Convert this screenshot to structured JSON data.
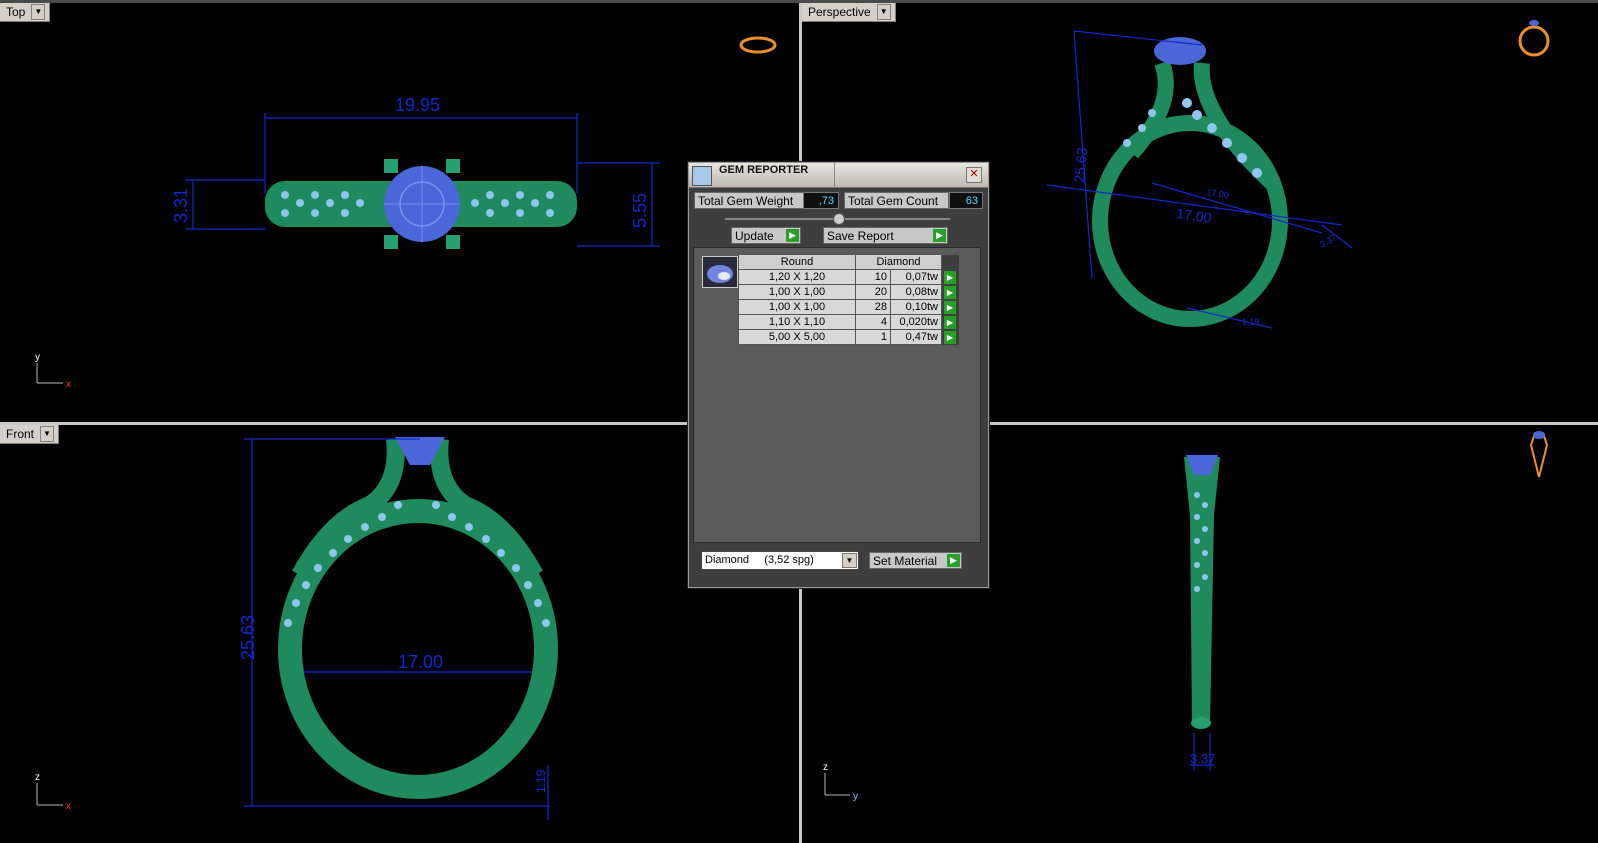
{
  "viewports": {
    "top": {
      "label": "Top",
      "dims": [
        "19.95",
        "3.31",
        "5.55"
      ],
      "axes": [
        "y",
        "x"
      ]
    },
    "perspective": {
      "label": "Perspective",
      "dims": [
        "25.63",
        "17.00",
        "17.00",
        "1.19",
        "3.37"
      ]
    },
    "front": {
      "label": "Front",
      "dims": [
        "25.63",
        "17.00",
        "1.19"
      ],
      "axes": [
        "z",
        "x"
      ]
    },
    "right": {
      "dims": [
        "3.37"
      ],
      "axes": [
        "z",
        "y"
      ]
    }
  },
  "gem_reporter": {
    "title": "GEM REPORTER",
    "total_weight_label": "Total Gem Weight",
    "total_weight_value": ",73",
    "total_count_label": "Total Gem Count",
    "total_count_value": "63",
    "update_label": "Update",
    "save_report_label": "Save Report",
    "table": {
      "headers": [
        "Round",
        "Diamond"
      ],
      "rows": [
        {
          "size": "1,20 X 1,20",
          "count": "10",
          "weight": "0,07tw"
        },
        {
          "size": "1,00 X 1,00",
          "count": "20",
          "weight": "0,08tw"
        },
        {
          "size": "1,00 X 1,00",
          "count": "28",
          "weight": "0,10tw"
        },
        {
          "size": "1,10 X 1,10",
          "count": "4",
          "weight": "0,020tw"
        },
        {
          "size": "5,00 X 5,00",
          "count": "1",
          "weight": "0,47tw"
        }
      ]
    },
    "material_select": "Diamond     (3,52 spg)",
    "set_material_label": "Set Material"
  },
  "colors": {
    "ring_green": "#1f8a5e",
    "gem_blue": "#4a66d8",
    "stone_light": "#8fc6f0",
    "dimension": "#1428c8",
    "background": "#000000"
  }
}
